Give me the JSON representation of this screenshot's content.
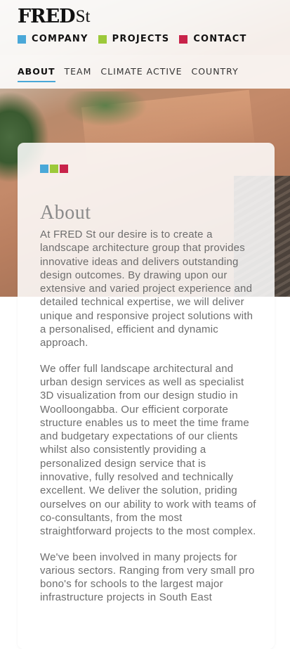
{
  "brand": {
    "logo_main": "FRED",
    "logo_suffix": "St"
  },
  "colors": {
    "blue": "#4aa8d8",
    "green": "#9cc93a",
    "red": "#c8234a",
    "underline": "#4aa8d8"
  },
  "top_nav": [
    {
      "label": "COMPANY",
      "color_key": "blue"
    },
    {
      "label": "PROJECTS",
      "color_key": "green"
    },
    {
      "label": "CONTACT",
      "color_key": "red"
    }
  ],
  "sub_nav": [
    {
      "label": "ABOUT",
      "active": true
    },
    {
      "label": "TEAM",
      "active": false
    },
    {
      "label": "CLIMATE ACTIVE",
      "active": false
    },
    {
      "label": "COUNTRY",
      "active": false
    }
  ],
  "content": {
    "title": "About",
    "paragraphs": [
      "At FRED St our desire is to create a landscape architecture group that provides innovative ideas and delivers outstanding design outcomes. By drawing upon our extensive and varied project experience and detailed technical expertise, we will deliver unique and responsive project solutions with a personalised, efficient and dynamic approach.",
      "We offer full landscape architectural and urban design services as well as specialist 3D visualization from our design studio in Woolloongabba. Our efficient corporate structure enables us to meet the time frame and budgetary expectations of our clients whilst also consistently providing a personalized design service that is innovative, fully resolved and technically excellent. We deliver the solution, priding ourselves on our ability to work with teams of co-consultants, from the most straightforward projects to the most complex.",
      "We've been involved in many projects for various sectors. Ranging from very small pro bono's for schools to the largest major infrastructure projects in South East"
    ]
  }
}
